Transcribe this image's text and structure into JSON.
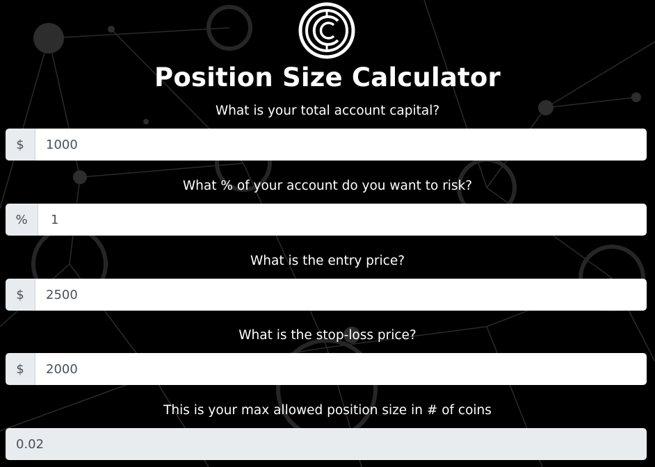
{
  "title": "Position Size Calculator",
  "logo": {
    "icon": "crypto-c-logo-icon"
  },
  "fields": [
    {
      "label": "What is your total account capital?",
      "prefix": "$",
      "value": "1000"
    },
    {
      "label": "What % of your account do you want to risk?",
      "prefix": "%",
      "value": "1"
    },
    {
      "label": "What is the entry price?",
      "prefix": "$",
      "value": "2500"
    },
    {
      "label": "What is the stop-loss price?",
      "prefix": "$",
      "value": "2000"
    }
  ],
  "result": {
    "label": "This is your max allowed position size in # of coins",
    "value": "0.02"
  },
  "colors": {
    "background": "#000000",
    "addon_bg": "#e9ecef",
    "input_bg": "#ffffff",
    "input_text": "#495057"
  }
}
